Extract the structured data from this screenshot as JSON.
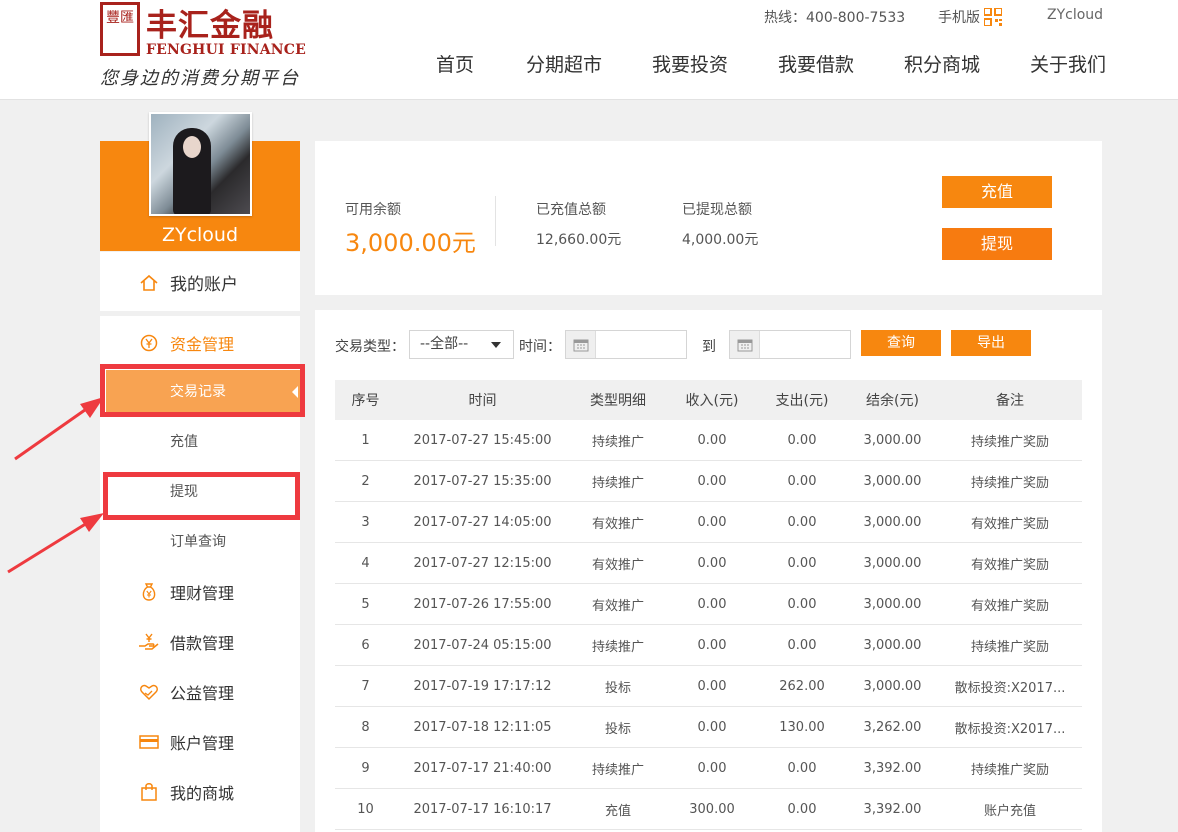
{
  "brand": {
    "seal_text": "豐匯",
    "name_cn": "丰汇金融",
    "name_en": "FENGHUI FINANCE",
    "slogan": "您身边的消费分期平台",
    "color": "#a8221c"
  },
  "topbar": {
    "hotline": "热线：400-800-7533",
    "mobile": "手机版",
    "user": "ZYcloud"
  },
  "nav": [
    "首页",
    "分期超市",
    "我要投资",
    "我要借款",
    "积分商城",
    "关于我们"
  ],
  "accent": "#f7870f",
  "profile": {
    "username": "ZYcloud"
  },
  "sidebar": {
    "my_account": "我的账户",
    "groups": [
      {
        "label": "资金管理",
        "icon": "yen-circle-icon"
      },
      {
        "label": "理财管理",
        "icon": "money-bag-icon"
      },
      {
        "label": "借款管理",
        "icon": "hand-yen-icon"
      },
      {
        "label": "公益管理",
        "icon": "heart-hand-icon"
      },
      {
        "label": "账户管理",
        "icon": "card-icon"
      },
      {
        "label": "我的商城",
        "icon": "shopping-bag-icon"
      }
    ],
    "sub_items": [
      "交易记录",
      "充值",
      "提现",
      "订单查询"
    ]
  },
  "balance": {
    "available_label": "可用余额",
    "available_value": "3,000.00元",
    "recharged_label": "已充值总额",
    "recharged_value": "12,660.00元",
    "withdrawn_label": "已提现总额",
    "withdrawn_value": "4,000.00元",
    "recharge_btn": "充值",
    "withdraw_btn": "提现"
  },
  "filter": {
    "type_label": "交易类型：",
    "type_value": "--全部--",
    "time_label": "时间：",
    "to_label": "到",
    "query_btn": "查询",
    "export_btn": "导出"
  },
  "table": {
    "headers": [
      "序号",
      "时间",
      "类型明细",
      "收入(元)",
      "支出(元)",
      "结余(元)",
      "备注"
    ],
    "rows": [
      [
        "1",
        "2017-07-27 15:45:00",
        "持续推广",
        "0.00",
        "0.00",
        "3,000.00",
        "持续推广奖励"
      ],
      [
        "2",
        "2017-07-27 15:35:00",
        "持续推广",
        "0.00",
        "0.00",
        "3,000.00",
        "持续推广奖励"
      ],
      [
        "3",
        "2017-07-27 14:05:00",
        "有效推广",
        "0.00",
        "0.00",
        "3,000.00",
        "有效推广奖励"
      ],
      [
        "4",
        "2017-07-27 12:15:00",
        "有效推广",
        "0.00",
        "0.00",
        "3,000.00",
        "有效推广奖励"
      ],
      [
        "5",
        "2017-07-26 17:55:00",
        "有效推广",
        "0.00",
        "0.00",
        "3,000.00",
        "有效推广奖励"
      ],
      [
        "6",
        "2017-07-24 05:15:00",
        "持续推广",
        "0.00",
        "0.00",
        "3,000.00",
        "持续推广奖励"
      ],
      [
        "7",
        "2017-07-19 17:17:12",
        "投标",
        "0.00",
        "262.00",
        "3,000.00",
        "散标投资:X2017..."
      ],
      [
        "8",
        "2017-07-18 12:11:05",
        "投标",
        "0.00",
        "130.00",
        "3,262.00",
        "散标投资:X2017..."
      ],
      [
        "9",
        "2017-07-17 21:40:00",
        "持续推广",
        "0.00",
        "0.00",
        "3,392.00",
        "持续推广奖励"
      ],
      [
        "10",
        "2017-07-17 16:10:17",
        "充值",
        "300.00",
        "0.00",
        "3,392.00",
        "账户充值"
      ]
    ]
  }
}
